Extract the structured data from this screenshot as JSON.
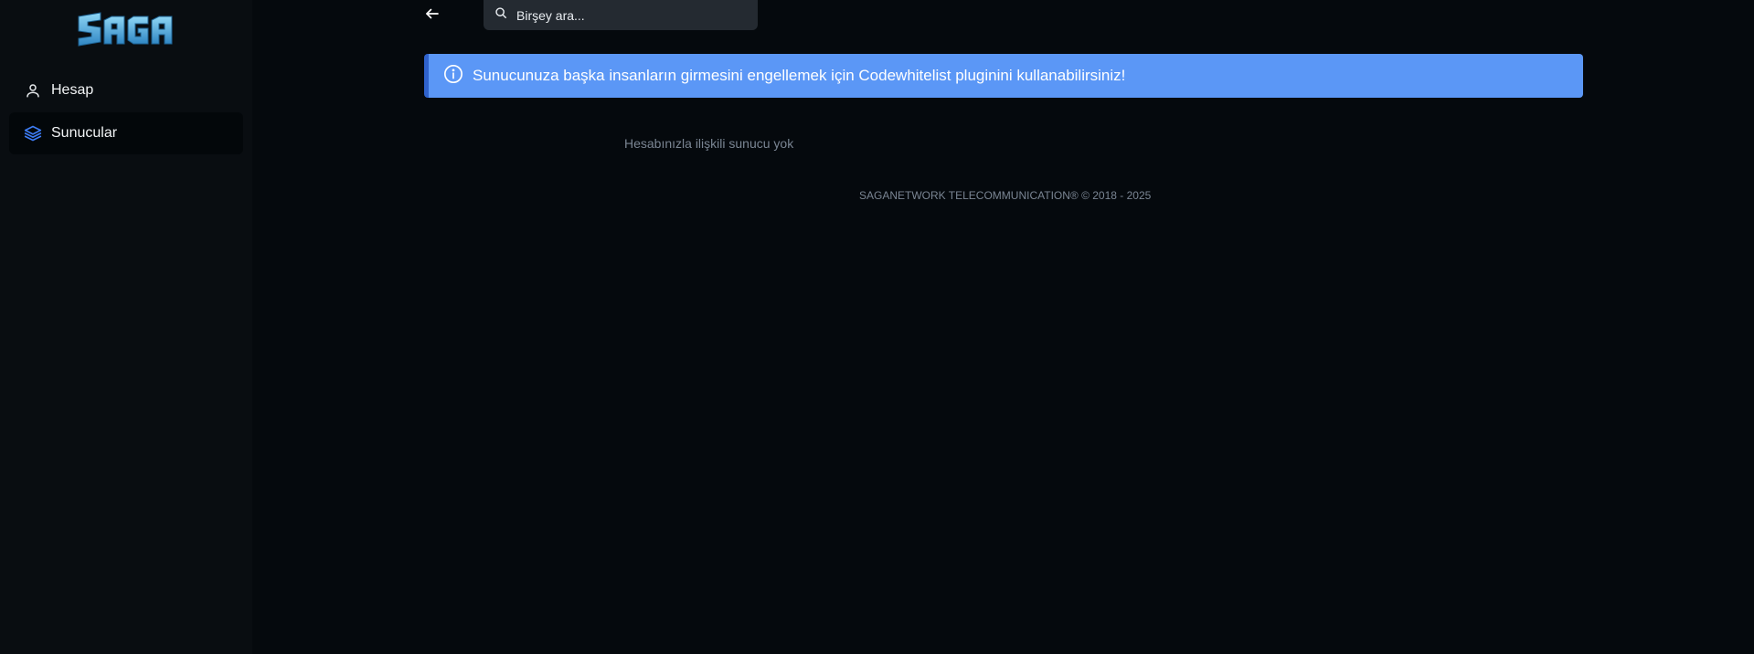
{
  "brand": {
    "logo_text": "SAGA",
    "logo_color": "#4fb3e8"
  },
  "sidebar": {
    "items": [
      {
        "label": "Hesap",
        "icon": "user-icon",
        "active": false
      },
      {
        "label": "Sunucular",
        "icon": "layers-icon",
        "active": true
      }
    ]
  },
  "header": {
    "back_icon": "arrow-left-icon",
    "search": {
      "placeholder": "Birşey ara...",
      "icon": "search-icon"
    }
  },
  "alert": {
    "icon": "info-icon",
    "text": "Sunucunuza başka insanların girmesini engellemek için Codewhitelist pluginini kullanabilirsiniz!",
    "color": "#5b97f6"
  },
  "servers": {
    "empty_text": "Hesabınızla ilişkili sunucu yok"
  },
  "footer": {
    "text": "SAGANETWORK TELECOMMUNICATION® © 2018 - 2025"
  }
}
